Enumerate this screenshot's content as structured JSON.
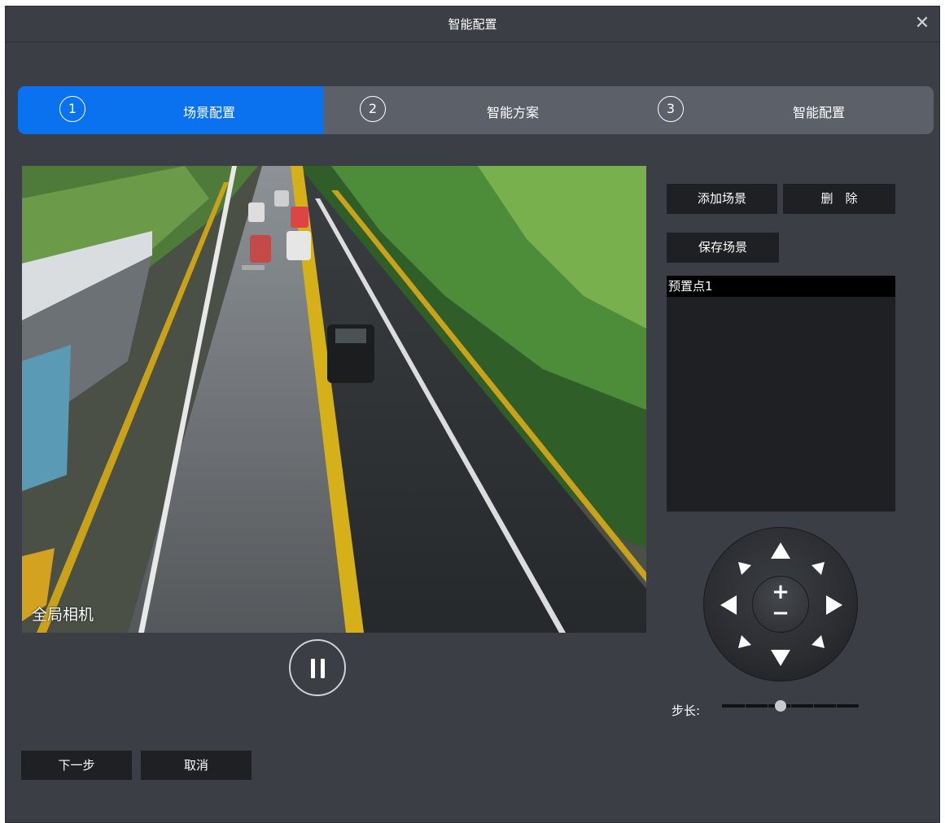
{
  "window": {
    "title": "智能配置",
    "close_icon": "close-icon"
  },
  "steps": [
    {
      "number": "1",
      "label": "场景配置",
      "active": true
    },
    {
      "number": "2",
      "label": "智能方案",
      "active": false
    },
    {
      "number": "3",
      "label": "智能配置",
      "active": false
    }
  ],
  "video": {
    "camera_label": "全局相机",
    "playback_state": "playing"
  },
  "scene_buttons": {
    "add": "添加场景",
    "delete": "删　除",
    "save": "保存场景"
  },
  "preset_list": {
    "items": [
      "预置点1"
    ],
    "selected_index": 0
  },
  "ptz": {
    "zoom_in": "+",
    "zoom_out": "−"
  },
  "step_length": {
    "label": "步长:",
    "value_fraction": 0.43
  },
  "footer": {
    "next": "下一步",
    "cancel": "取消"
  },
  "colors": {
    "accent": "#0a72ef",
    "background": "#3b3e44",
    "button_bg": "#1e2023",
    "step_bar": "#5c6068"
  }
}
